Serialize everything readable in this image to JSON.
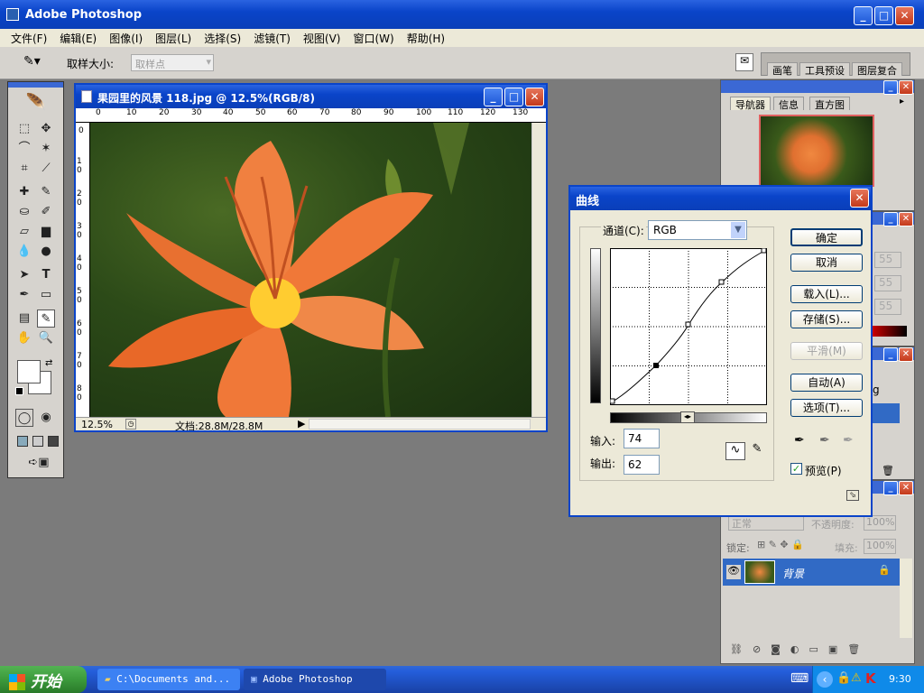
{
  "app": {
    "title": "Adobe Photoshop"
  },
  "menu": [
    "文件(F)",
    "编辑(E)",
    "图像(I)",
    "图层(L)",
    "选择(S)",
    "滤镜(T)",
    "视图(V)",
    "窗口(W)",
    "帮助(H)"
  ],
  "options": {
    "sample_label": "取样大小:",
    "sample_value": "取样点",
    "panel_tabs": [
      "画笔",
      "工具预设",
      "图层复合"
    ]
  },
  "document": {
    "title": "果园里的风景 118.jpg @ 12.5%(RGB/8)",
    "zoom": "12.5%",
    "doc_info": "文档:28.8M/28.8M",
    "ruler_h": [
      "0",
      "10",
      "20",
      "30",
      "40",
      "50",
      "60",
      "70",
      "80",
      "90",
      "100",
      "110",
      "120",
      "130"
    ],
    "ruler_v": [
      "0",
      "1 0",
      "2 0",
      "3 0",
      "4 0",
      "5 0",
      "6 0",
      "7 0",
      "8 0"
    ]
  },
  "curves": {
    "title": "曲线",
    "channel_label": "通道(C):",
    "channel_value": "RGB",
    "ok": "确定",
    "cancel": "取消",
    "load": "载入(L)...",
    "save": "存储(S)...",
    "smooth": "平滑(M)",
    "auto": "自动(A)",
    "options": "选项(T)...",
    "input_label": "输入:",
    "input_value": "74",
    "output_label": "输出:",
    "output_value": "62",
    "preview_label": "预览(P)",
    "preview_checked": true
  },
  "navigator": {
    "tabs": [
      "导航器",
      "信息",
      "直方图"
    ]
  },
  "color_panel": {
    "values": [
      "55",
      "55",
      "55"
    ]
  },
  "history_panel": {
    "snippet": "g"
  },
  "layers": {
    "blend": "正常",
    "opacity_label": "不透明度:",
    "opacity": "100%",
    "lock_label": "锁定:",
    "fill_label": "填充:",
    "fill": "100%",
    "layer_name": "背景"
  },
  "taskbar": {
    "start": "开始",
    "items": [
      "C:\\Documents and...",
      "Adobe Photoshop"
    ],
    "time": "9:30"
  },
  "colors": {
    "xp_blue": "#0a44c9",
    "taskbar": "#245edb",
    "start_green": "#3c9a3c",
    "select_blue": "#316ac5"
  }
}
